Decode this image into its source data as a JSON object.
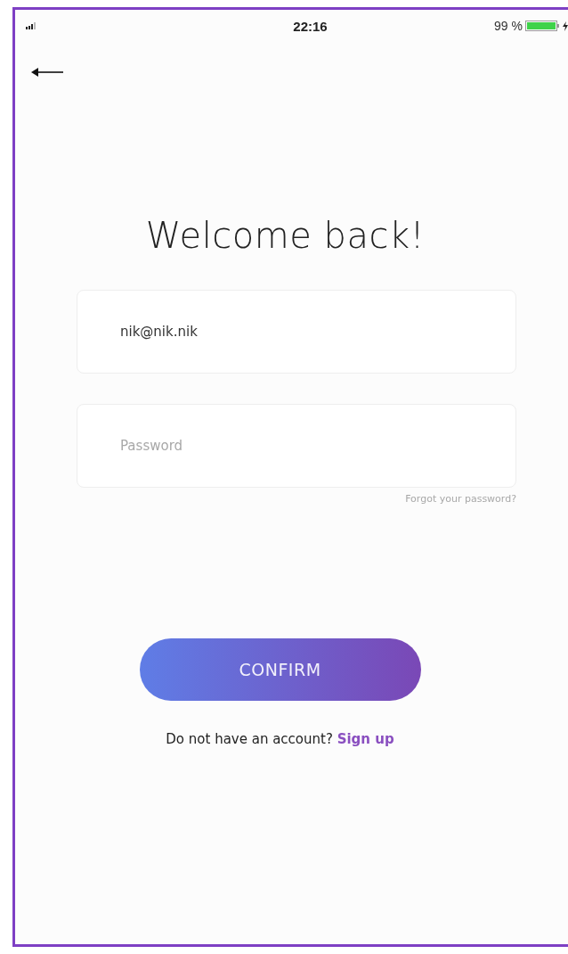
{
  "status_bar": {
    "time": "22:16",
    "battery": "99 %"
  },
  "title": "Welcome back!",
  "fields": [
    {
      "kind": "email",
      "value": "nik@nik.nik"
    },
    {
      "kind": "password",
      "placeholder": "Password"
    }
  ],
  "forgot_link": "Forgot your password?",
  "confirm_button": "CONFIRM",
  "signup": {
    "prompt": "Do not have an account?",
    "link": "Sign up"
  }
}
